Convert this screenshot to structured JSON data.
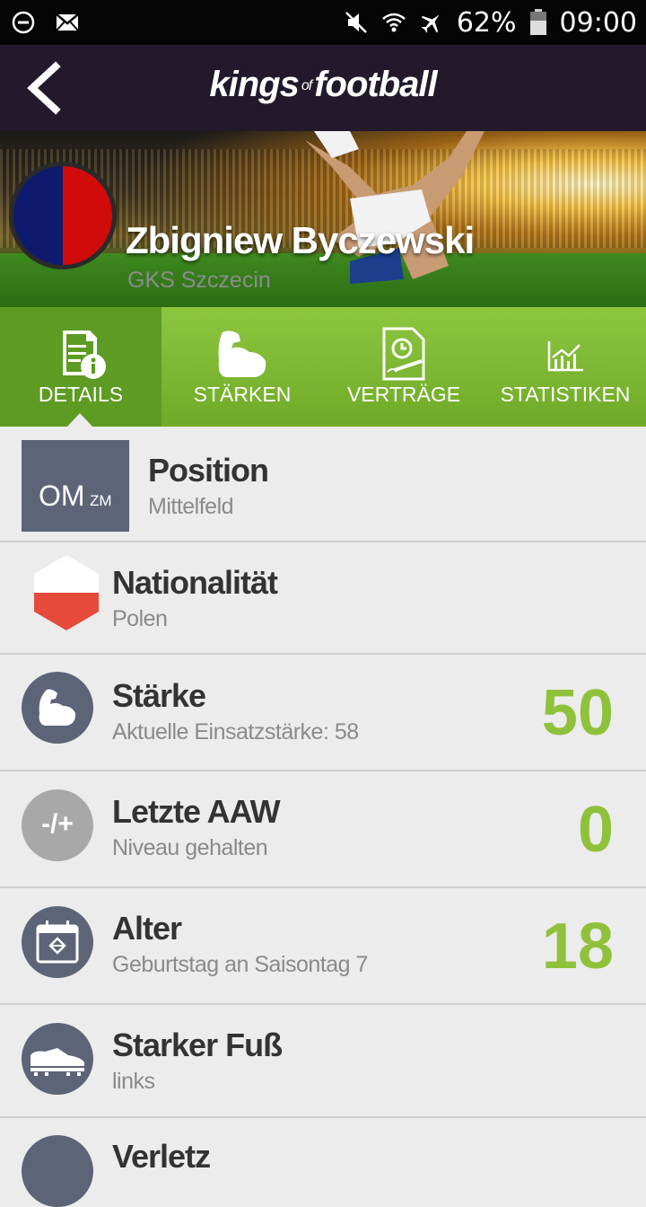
{
  "status_bar": {
    "battery": "62%",
    "time": "09:00"
  },
  "app_bar": {
    "logo_left": "kings",
    "logo_of": "of",
    "logo_right": "football"
  },
  "player": {
    "name": "Zbigniew Byczewski",
    "club": "GKS Szczecin"
  },
  "colors": {
    "accent_green": "#8fc13b",
    "tab_green": "#7ab530",
    "header_dark": "#221a2b",
    "icon_slate": "#5d6478"
  },
  "tabs": [
    {
      "label": "DETAILS",
      "icon": "details-icon",
      "active": true
    },
    {
      "label": "STÄRKEN",
      "icon": "strength-arm-icon",
      "active": false
    },
    {
      "label": "VERTRÄGE",
      "icon": "contract-icon",
      "active": false
    },
    {
      "label": "STATISTIKEN",
      "icon": "stats-chart-icon",
      "active": false
    }
  ],
  "details": {
    "position": {
      "main": "OM",
      "secondary": "ZM",
      "title": "Position",
      "subtitle": "Mittelfeld"
    },
    "nationality": {
      "title": "Nationalität",
      "subtitle": "Polen"
    },
    "strength": {
      "title": "Stärke",
      "subtitle": "Aktuelle Einsatzstärke: 58",
      "value": "50"
    },
    "last_aaw": {
      "title": "Letzte AAW",
      "subtitle": "Niveau gehalten",
      "value": "0",
      "icon_text": "-/+"
    },
    "age": {
      "title": "Alter",
      "subtitle": "Geburtstag an Saisontag 7",
      "value": "18"
    },
    "strong_foot": {
      "title": "Starker Fuß",
      "subtitle": "links"
    },
    "next_partial": {
      "title": "Verletz"
    }
  }
}
